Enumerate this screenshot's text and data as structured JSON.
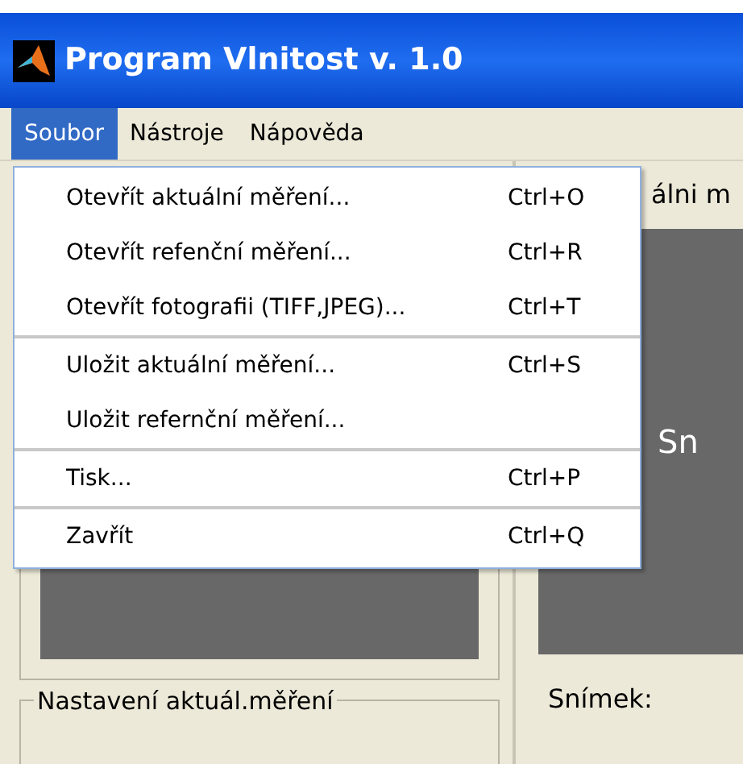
{
  "window": {
    "title": "Program Vlnitost v. 1.0"
  },
  "menu_bar": [
    {
      "label": "Soubor",
      "selected": true
    },
    {
      "label": "Nástroje",
      "selected": false
    },
    {
      "label": "Nápověda",
      "selected": false
    }
  ],
  "dropdown": {
    "groups": [
      [
        {
          "label": "Otevřít aktuální měření...",
          "shortcut": "Ctrl+O"
        },
        {
          "label": "Otevřít refenční měření...",
          "shortcut": "Ctrl+R"
        },
        {
          "label": "Otevřít fotografii (TIFF,JPEG)...",
          "shortcut": "Ctrl+T"
        }
      ],
      [
        {
          "label": "Uložit aktuální měření...",
          "shortcut": "Ctrl+S"
        },
        {
          "label": "Uložit refernční měření..."
        }
      ],
      [
        {
          "label": "Tisk...",
          "shortcut": "Ctrl+P"
        }
      ],
      [
        {
          "label": "Zavřít",
          "shortcut": "Ctrl+Q"
        }
      ]
    ]
  },
  "left_panel": {
    "group_label": "Nastavení aktuál.měření"
  },
  "right_panel": {
    "heading": "álni m",
    "image_text": "Sn",
    "frame_label": "Snímek:"
  }
}
